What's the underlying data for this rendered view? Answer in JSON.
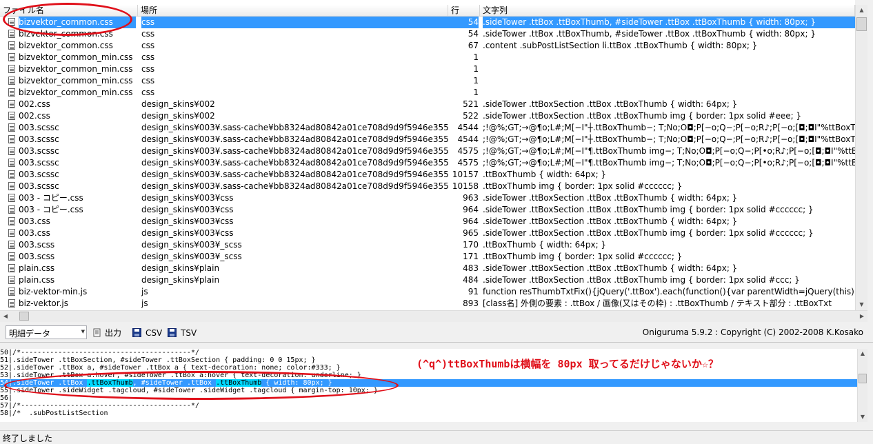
{
  "columns": {
    "file": "ファイル名",
    "path": "場所",
    "line": "行",
    "text": "文字列"
  },
  "rows": [
    {
      "file": "bizvektor_common.css",
      "path": "css",
      "line": "54",
      "text": ".sideTower .ttBox .ttBoxThumb, #sideTower .ttBox .ttBoxThumb { width: 80px; }",
      "selected": true
    },
    {
      "file": "bizvektor_common.css",
      "path": "css",
      "line": "54",
      "text": ".sideTower .ttBox .ttBoxThumb, #sideTower .ttBox .ttBoxThumb { width: 80px; }"
    },
    {
      "file": "bizvektor_common.css",
      "path": "css",
      "line": "67",
      "text": ".content .subPostListSection li.ttBox .ttBoxThumb { width: 80px; }"
    },
    {
      "file": "bizvektor_common_min.css",
      "path": "css",
      "line": "1",
      "text": ""
    },
    {
      "file": "bizvektor_common_min.css",
      "path": "css",
      "line": "1",
      "text": ""
    },
    {
      "file": "bizvektor_common_min.css",
      "path": "css",
      "line": "1",
      "text": ""
    },
    {
      "file": "bizvektor_common_min.css",
      "path": "css",
      "line": "1",
      "text": ""
    },
    {
      "file": "002.css",
      "path": "design_skins¥002",
      "line": "521",
      "text": ".sideTower .ttBoxSection .ttBox .ttBoxThumb { width: 64px; }"
    },
    {
      "file": "002.css",
      "path": "design_skins¥002",
      "line": "522",
      "text": ".sideTower .ttBoxSection .ttBox .ttBoxThumb img { border: 1px solid #eee; }"
    },
    {
      "file": "003.scssc",
      "path": "design_skins¥003¥.sass-cache¥bb8324ad80842a01ce708d9d9f5946e35584ee69",
      "line": "4544",
      "text": ";!@%;GT;→@¶o;L#;M[−I\"┼.ttBoxThumb−;     T;No;O◘;P[−o;Q−;P[−o;R♪;P[−o;[◘;◘I\"%ttBoxThumb−;"
    },
    {
      "file": "003.scssc",
      "path": "design_skins¥003¥.sass-cache¥bb8324ad80842a01ce708d9d9f5946e35584ee69",
      "line": "4544",
      "text": ";!@%;GT;→@¶o;L#;M[−I\"┼.ttBoxThumb−;     T;No;O◘;P[−o;Q−;P[−o;R♪;P[−o;[◘;◘I\"%ttBoxThumb−;"
    },
    {
      "file": "003.scssc",
      "path": "design_skins¥003¥.sass-cache¥bb8324ad80842a01ce708d9d9f5946e35584ee69",
      "line": "4575",
      "text": ";!@%;GT;→@¶o;L#;M[−I\"¶.ttBoxThumb img−;     T;No;O◘;P[−o;Q−;P[•o;R♪;P[−o;[◘;◘I\"%ttBoxThumb−"
    },
    {
      "file": "003.scssc",
      "path": "design_skins¥003¥.sass-cache¥bb8324ad80842a01ce708d9d9f5946e35584ee69",
      "line": "4575",
      "text": ";!@%;GT;→@¶o;L#;M[−I\"¶.ttBoxThumb img−;     T;No;O◘;P[−o;Q−;P[•o;R♪;P[−o;[◘;◘I\"%ttBoxThumb−"
    },
    {
      "file": "003.scssc",
      "path": "design_skins¥003¥.sass-cache¥bb8324ad80842a01ce708d9d9f5946e35584ee69",
      "line": "10157",
      "text": "            .ttBoxThumb { width: 64px; }"
    },
    {
      "file": "003.scssc",
      "path": "design_skins¥003¥.sass-cache¥bb8324ad80842a01ce708d9d9f5946e35584ee69",
      "line": "10158",
      "text": "            .ttBoxThumb img { border: 1px solid #cccccc; }"
    },
    {
      "file": "003 - コピー.css",
      "path": "design_skins¥003¥css",
      "line": "963",
      "text": ".sideTower .ttBoxSection .ttBox .ttBoxThumb { width: 64px; }"
    },
    {
      "file": "003 - コピー.css",
      "path": "design_skins¥003¥css",
      "line": "964",
      "text": ".sideTower .ttBoxSection .ttBox .ttBoxThumb img { border: 1px solid #cccccc; }"
    },
    {
      "file": "003.css",
      "path": "design_skins¥003¥css",
      "line": "964",
      "text": ".sideTower .ttBoxSection .ttBox .ttBoxThumb { width: 64px; }"
    },
    {
      "file": "003.css",
      "path": "design_skins¥003¥css",
      "line": "965",
      "text": ".sideTower .ttBoxSection .ttBox .ttBoxThumb img { border: 1px solid #cccccc; }"
    },
    {
      "file": "003.scss",
      "path": "design_skins¥003¥_scss",
      "line": "170",
      "text": "            .ttBoxThumb { width: 64px; }"
    },
    {
      "file": "003.scss",
      "path": "design_skins¥003¥_scss",
      "line": "171",
      "text": "            .ttBoxThumb img { border: 1px solid #cccccc; }"
    },
    {
      "file": "plain.css",
      "path": "design_skins¥plain",
      "line": "483",
      "text": ".sideTower .ttBoxSection .ttBox .ttBoxThumb { width: 64px; }"
    },
    {
      "file": "plain.css",
      "path": "design_skins¥plain",
      "line": "484",
      "text": ".sideTower .ttBoxSection .ttBox .ttBoxThumb img { border: 1px solid #ccc; }"
    },
    {
      "file": "biz-vektor-min.js",
      "path": "js",
      "line": "91",
      "text": "function resThumbTxtFix(){jQuery('.ttBox').each(function(){var parentWidth=jQuery(this).width()"
    },
    {
      "file": "biz-vektor.js",
      "path": "js",
      "line": "893",
      "text": "[class名] 外側の要素 : .ttBox / 画像(又はその枠) : .ttBoxThumb / テキスト部分 : .ttBoxTxt"
    }
  ],
  "toolbar": {
    "mode": "明細データ",
    "output": "出力",
    "csv": "CSV",
    "tsv": "TSV",
    "copyright": "Oniguruma 5.9.2 : Copyright (C) 2002-2008 K.Kosako"
  },
  "code_lines": [
    {
      "text": "50|/*-----------------------------------------*/"
    },
    {
      "text": "51|.sideTower .ttBoxSection, #sideTower .ttBoxSection { padding: 0 0 15px; }"
    },
    {
      "text": "52|.sideTower .ttBox a, #sideTower .ttBox a { text-decoration: none; color:#333; }"
    },
    {
      "text": "53|.sideTower .ttBox a:hover, #sideTower .ttBox a:hover { text-decoration: underline; }"
    },
    {
      "text": "54|.sideTower .ttBox .ttBoxThumb, #sideTower .ttBox .ttBoxThumb { width: 80px; }",
      "hl": true
    },
    {
      "text": "55|.sideTower .sideWidget .tagcloud, #sideTower .sideWidget .tagcloud { margin-top: 10px; }"
    },
    {
      "text": "56|"
    },
    {
      "text": "57|/*-----------------------------------------*/"
    },
    {
      "text": "58|/*  .subPostListSection"
    }
  ],
  "annotation": "(^q^)ttBoxThumbは横幅を 80px 取ってるだけじゃないか☆？",
  "status": "終了しました",
  "colors": {
    "selection": "#3399ff",
    "annotation": "#e0101a",
    "match": "#00d8ff"
  }
}
